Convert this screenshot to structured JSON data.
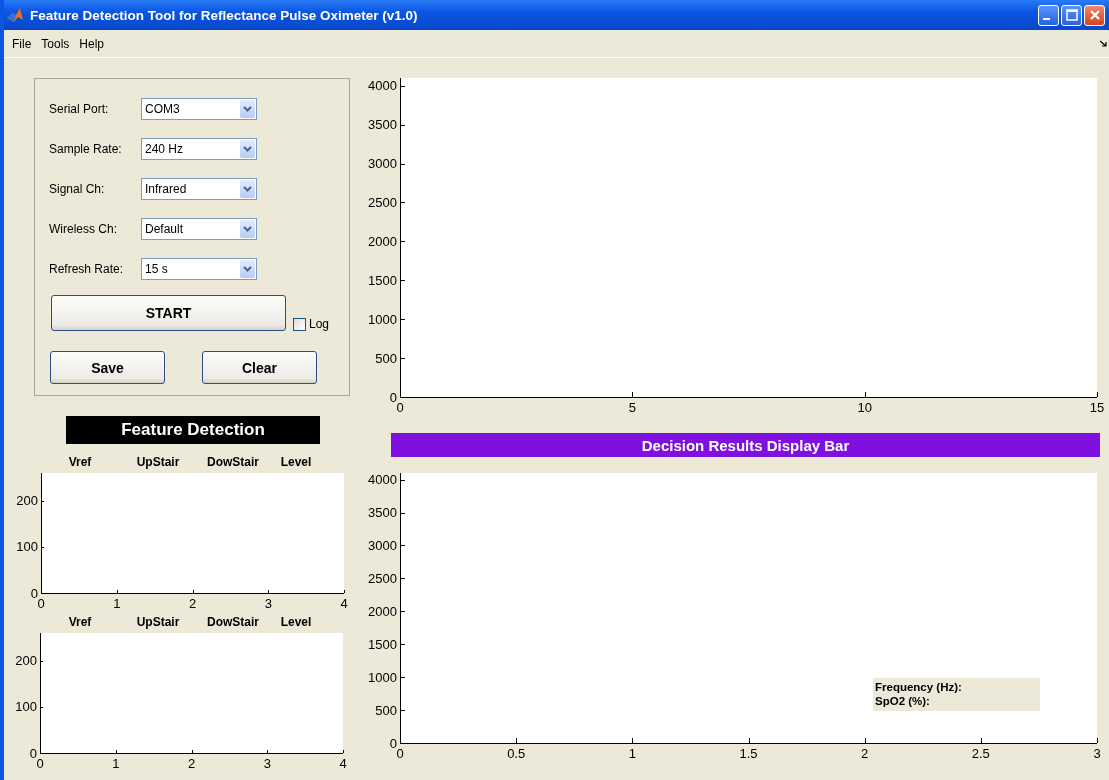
{
  "window": {
    "title": "Feature Detection Tool for Reflectance Pulse Oximeter (v1.0)"
  },
  "menu": [
    "File",
    "Tools",
    "Help"
  ],
  "settings": [
    {
      "label": "Serial Port:",
      "value": "COM3"
    },
    {
      "label": "Sample Rate:",
      "value": "240 Hz"
    },
    {
      "label": "Signal Ch:",
      "value": "Infrared"
    },
    {
      "label": "Wireless Ch:",
      "value": "Default"
    },
    {
      "label": "Refresh Rate:",
      "value": "15 s"
    }
  ],
  "start_button": "START",
  "log": {
    "label": "Log",
    "checked": false
  },
  "buttons": [
    "Save",
    "Clear"
  ],
  "feature_detection": {
    "title": "Feature Detection",
    "plots": [
      {
        "headers": [
          "Vref",
          "UpStair",
          "DowStair",
          "Level"
        ],
        "x_tick_labels": [
          "0",
          "1",
          "2",
          "3",
          "4"
        ],
        "y_tick_labels": [
          "200",
          "100",
          "0"
        ]
      },
      {
        "headers": [
          "Vref",
          "UpStair",
          "DowStair",
          "Level"
        ],
        "x_tick_labels": [
          "0",
          "1",
          "2",
          "3",
          "4"
        ],
        "y_tick_labels": [
          "200",
          "100",
          "0"
        ]
      }
    ]
  },
  "signal_plot": {
    "x_tick_labels": [
      "0",
      "5",
      "10",
      "15"
    ],
    "y_tick_labels": [
      "4000",
      "3500",
      "3000",
      "2500",
      "2000",
      "1500",
      "1000",
      "500",
      "0"
    ]
  },
  "decision_bar": {
    "text": "Decision Results Display Bar"
  },
  "result_plot": {
    "x_tick_labels": [
      "0",
      "0.5",
      "1",
      "1.5",
      "2",
      "2.5",
      "3"
    ],
    "y_tick_labels": [
      "4000",
      "3500",
      "3000",
      "2500",
      "2000",
      "1500",
      "1000",
      "500",
      "0"
    ],
    "readouts": [
      "Frequency (Hz):",
      "SpO2 (%):"
    ]
  }
}
